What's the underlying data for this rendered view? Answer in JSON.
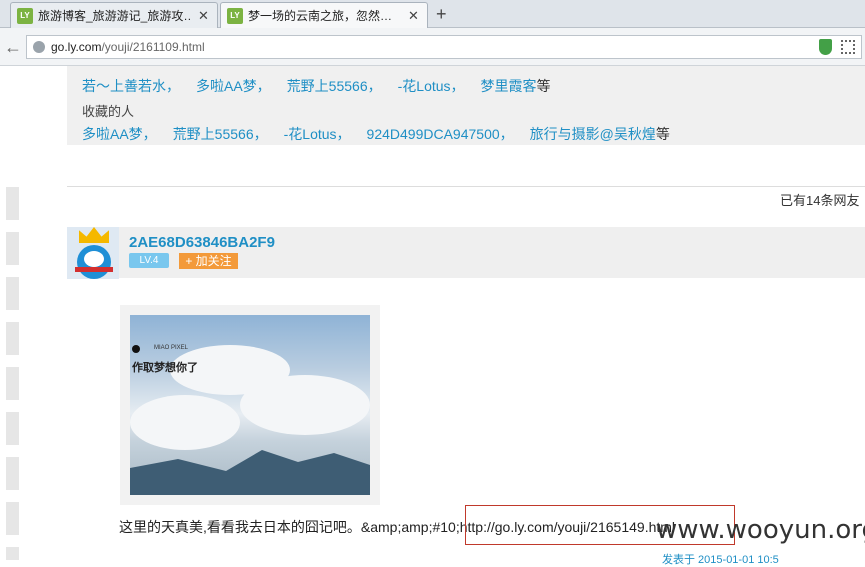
{
  "browser": {
    "tabs": [
      {
        "favicon": "LY",
        "title": "旅游博客_旅游游记_旅游攻…",
        "close": "✕"
      },
      {
        "favicon": "LY",
        "title": "梦一场的云南之旅，忽然…",
        "close": "✕"
      }
    ],
    "new_tab": "+",
    "back": "←",
    "url_domain": "go.ly.com",
    "url_path": "/youji/2161109.html"
  },
  "likes": {
    "users": [
      "若～上善若水，",
      "多啦AA梦，",
      "荒野上55566，",
      "-花Lotus，",
      "梦里霞客"
    ],
    "suffix": "等"
  },
  "favorites": {
    "label": "收藏的人",
    "users": [
      "多啦AA梦，",
      "荒野上55566，",
      "-花Lotus，",
      "924D499DCA947500，",
      "旅行与摄影@吴秋煌"
    ],
    "suffix": "等"
  },
  "comment_count": "已有14条网友",
  "comment": {
    "username": "2AE68D63846BA2F9",
    "level": "LV.4",
    "follow": "+ 加关注",
    "photo_text": "作取梦想你了",
    "photo_sig": "MIAO PIXEL",
    "text": "这里的天真美,看看我去日本的囧记吧。&amp;amp;#10;http://go.ly.com/youji/2165149.html",
    "timestamp": "发表于 2015-01-01 10:5"
  },
  "watermark": "www.wooyun.org",
  "colors": {
    "link": "#1f8fc5",
    "follow": "#f39a3a",
    "level": "#79c7ee",
    "highlight_box": "#c0392b"
  }
}
